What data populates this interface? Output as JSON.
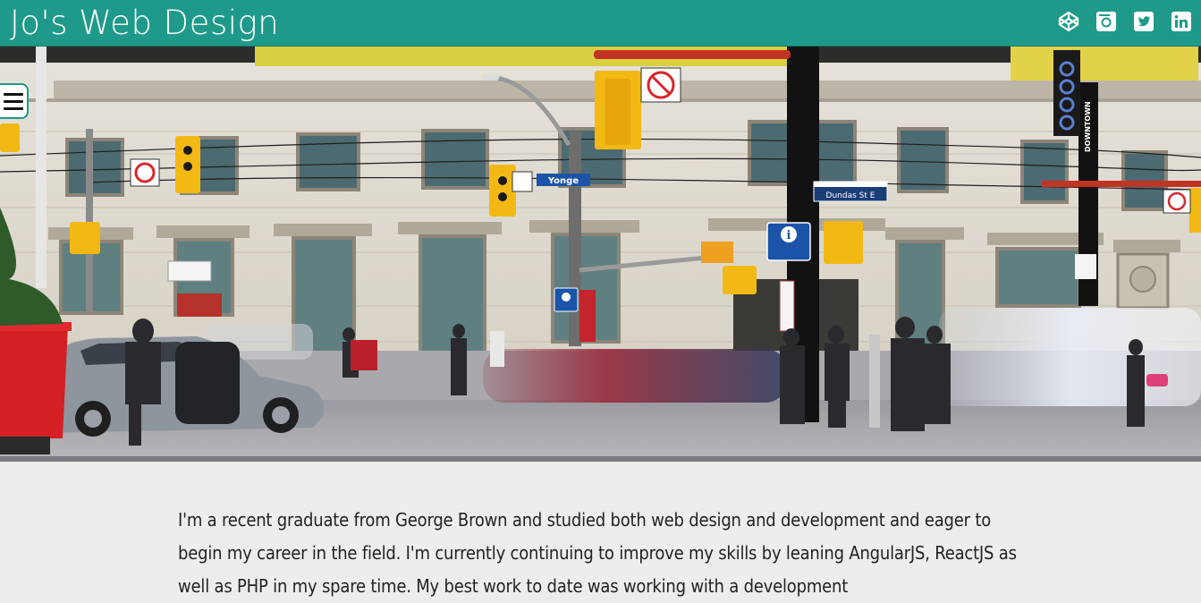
{
  "header": {
    "title": "Jo's Web Design",
    "social_links": [
      {
        "name": "codepen-icon"
      },
      {
        "name": "instagram-icon"
      },
      {
        "name": "twitter-icon"
      },
      {
        "name": "linkedin-icon"
      }
    ],
    "background_color": "#1f9a8a"
  },
  "hero": {
    "image_subject": "street-photo",
    "signs": {
      "yonge": "Yonge",
      "dundas": "Dundas St E",
      "downtown": "DOWNTOWN",
      "info": "i"
    }
  },
  "menu": {
    "icon": "hamburger-icon"
  },
  "intro": {
    "text": "I'm a recent graduate from George Brown and studied both web design and development and eager to begin my career in the field. I'm currently continuing to improve my skills by leaning AngularJS, ReactJS as well as PHP in my spare time. My best work to date was working with a development"
  }
}
